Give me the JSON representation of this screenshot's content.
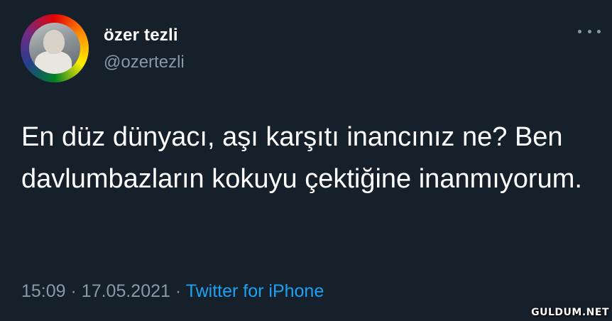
{
  "user": {
    "display_name": "özer tezli",
    "handle": "@ozertezli",
    "avatar_icon": "profile-avatar-rainbow-ring"
  },
  "tweet": {
    "text": "En düz dünyacı, aşı karşıtı inancınız ne? Ben davlumbazların kokuyu çektiğine inanmıyorum.",
    "time": "15:09",
    "separator": "·",
    "date": "17.05.2021",
    "source": "Twitter for iPhone"
  },
  "more_icon": "more-horizontal-icon",
  "watermark": "GULDUM.NET",
  "colors": {
    "background": "#15202b",
    "primary_text": "#ffffff",
    "secondary_text": "#8899a6",
    "link": "#1da1f2"
  }
}
